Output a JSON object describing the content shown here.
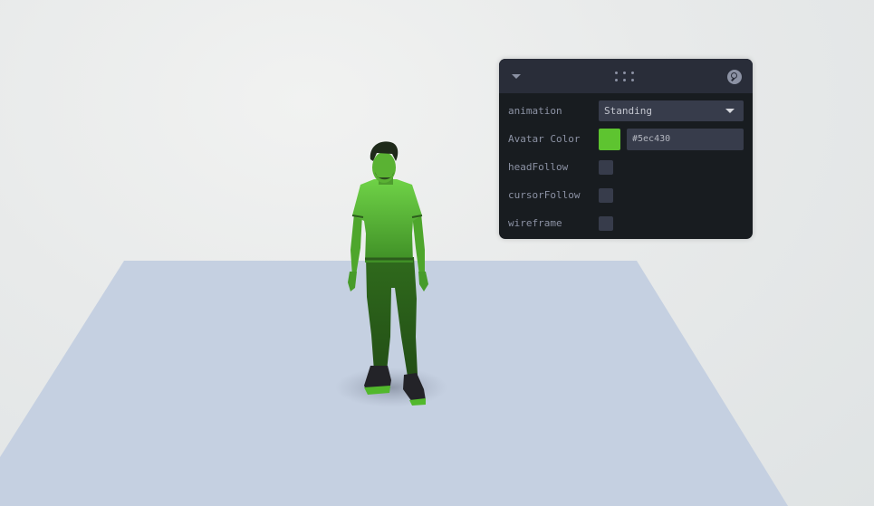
{
  "panel": {
    "controls": {
      "animation": {
        "label": "animation",
        "value": "Standing"
      },
      "avatar_color": {
        "label": "Avatar Color",
        "value": "#5ec430"
      },
      "head_follow": {
        "label": "headFollow",
        "checked": false
      },
      "cursor_follow": {
        "label": "cursorFollow",
        "checked": false
      },
      "wireframe": {
        "label": "wireframe",
        "checked": false
      }
    }
  },
  "icons": {
    "collapse": "chevron-down-icon",
    "drag": "drag-handle-icon",
    "search": "search-icon",
    "dropdown": "caret-down-icon"
  },
  "colors": {
    "background": "#e6e8e9",
    "floor": "#c5d0e1",
    "panel": "#181c20",
    "panel_title": "#292d39",
    "field": "#373c4b",
    "label": "#8c92a4"
  }
}
